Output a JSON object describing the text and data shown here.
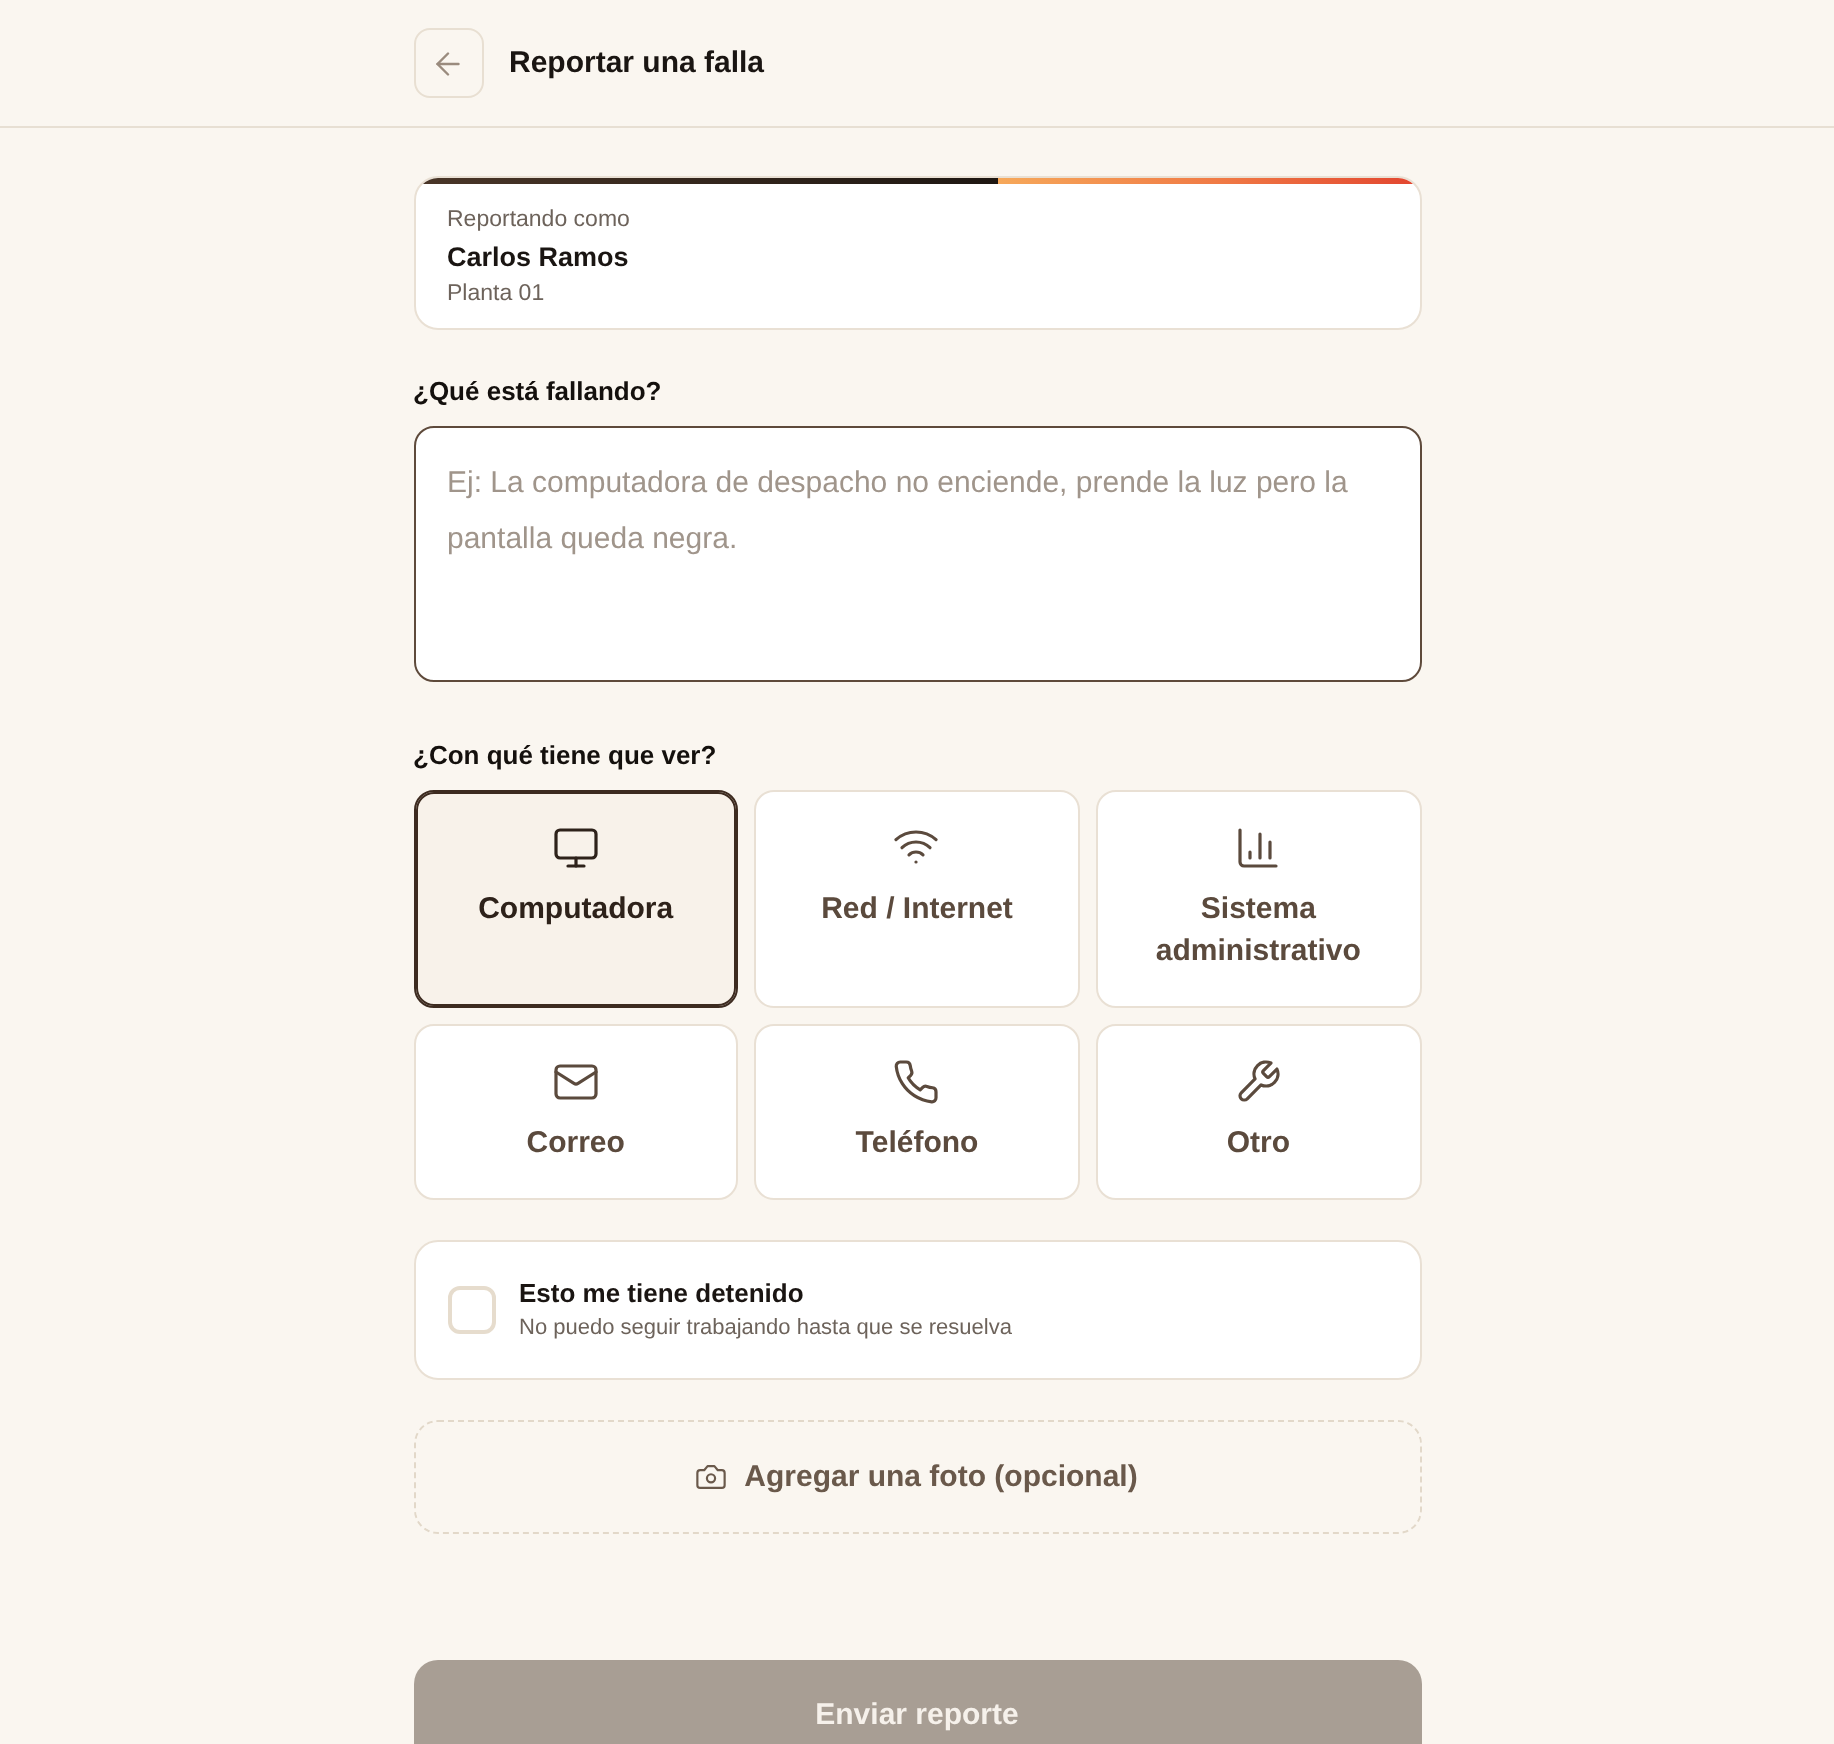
{
  "header": {
    "title": "Reportar una falla"
  },
  "reporter": {
    "caption": "Reportando como",
    "name": "Carlos Ramos",
    "location": "Planta 01"
  },
  "issue": {
    "label": "¿Qué está fallando?",
    "placeholder": "Ej: La computadora de despacho no enciende, prende la luz pero la pantalla queda negra.",
    "focused": true
  },
  "category": {
    "label": "¿Con qué tiene que ver?",
    "options": [
      {
        "label": "Computadora",
        "selected": true
      },
      {
        "label": "Red / Internet",
        "selected": false
      },
      {
        "label": "Sistema administrativo",
        "selected": false
      },
      {
        "label": "Correo",
        "selected": false
      },
      {
        "label": "Teléfono",
        "selected": false
      },
      {
        "label": "Otro",
        "selected": false
      }
    ]
  },
  "blocking": {
    "title": "Esto me tiene detenido",
    "subtitle": "No puedo seguir trabajando hasta que se resuelva",
    "checked": false
  },
  "photo": {
    "label": "Agregar una foto (opcional)"
  },
  "submit": {
    "label": "Enviar reporte",
    "disabled": true
  }
}
